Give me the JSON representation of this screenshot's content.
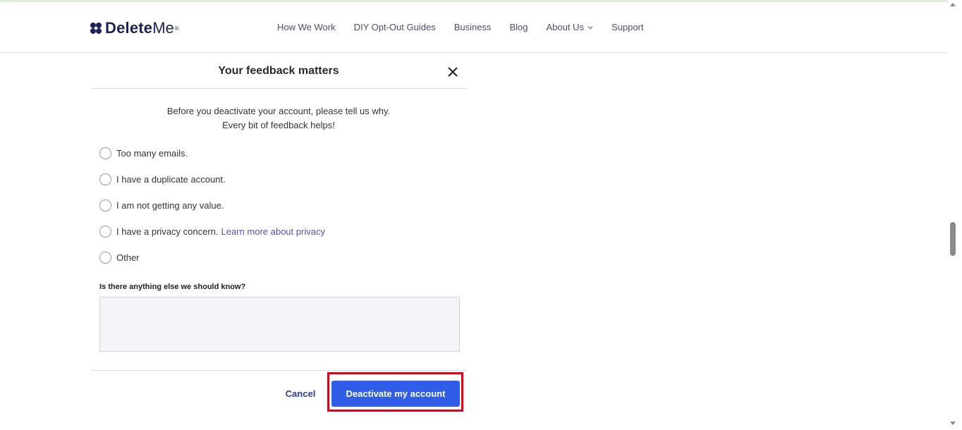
{
  "header": {
    "logo_bold": "Delete",
    "logo_light": "Me",
    "logo_reg": "®",
    "nav": [
      "How We Work",
      "DIY Opt-Out Guides",
      "Business",
      "Blog",
      "About Us",
      "Support"
    ]
  },
  "modal": {
    "title": "Your feedback matters",
    "intro_line1": "Before you deactivate your account, please tell us why.",
    "intro_line2": "Every bit of feedback helps!",
    "options": [
      {
        "label": "Too many emails."
      },
      {
        "label": "I have a duplicate account."
      },
      {
        "label": "I am not getting any value."
      },
      {
        "label": "I have a privacy concern.",
        "link": "Learn more about privacy"
      },
      {
        "label": "Other"
      }
    ],
    "more_label": "Is there anything else we should know?",
    "textarea_value": "",
    "cancel_label": "Cancel",
    "deactivate_label": "Deactivate my account"
  },
  "colors": {
    "brand_navy": "#1b2455",
    "primary_button": "#2f5de8",
    "highlight": "#e0001a",
    "link": "#4a55b8"
  }
}
